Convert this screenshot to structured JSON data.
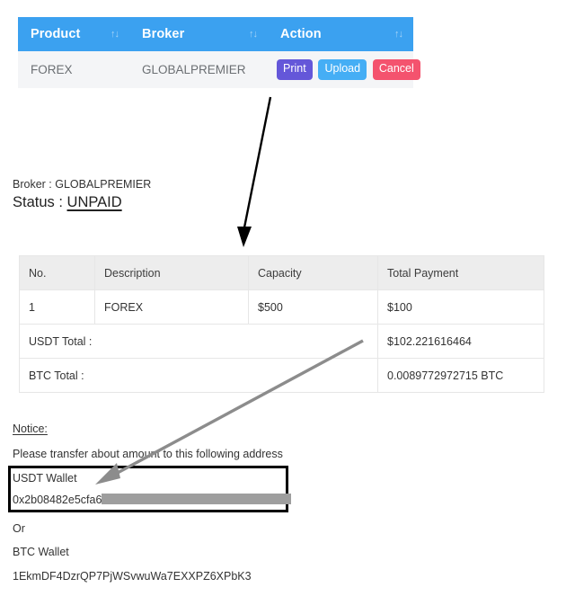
{
  "action_table": {
    "columns": [
      {
        "label": "Product",
        "sort_icon": "sort-updown-icon"
      },
      {
        "label": "Broker",
        "sort_icon": "sort-updown-icon"
      },
      {
        "label": "Action",
        "sort_icon": "sort-updown-icon"
      }
    ],
    "sort_glyph": "↑↓",
    "rows": [
      {
        "product": "FOREX",
        "broker": "GLOBALPREMIER",
        "buttons": [
          {
            "label": "Print",
            "color": "#6457d9"
          },
          {
            "label": "Upload",
            "color": "#45aef5"
          },
          {
            "label": "Cancel",
            "color": "#f4536e"
          }
        ]
      }
    ],
    "header_color": "#3ba1f0",
    "row_color": "#f4f5f7"
  },
  "summary": {
    "broker_label": "Broker : ",
    "broker_value": "GLOBALPREMIER",
    "status_label": "Status : ",
    "status_value": "UNPAID"
  },
  "invoice": {
    "columns": [
      "No.",
      "Description",
      "Capacity",
      "Total Payment"
    ],
    "rows": [
      {
        "no": "1",
        "description": "FOREX",
        "capacity": "$500",
        "total_payment": "$100"
      }
    ],
    "totals": [
      {
        "label": "USDT Total :",
        "value": "$102.221616464"
      },
      {
        "label": "BTC Total :",
        "value": "0.0089772972715 BTC"
      }
    ]
  },
  "notice": {
    "heading": "Notice:",
    "text": "Please transfer about amount to this following address",
    "usdt_wallet_label": "USDT Wallet",
    "usdt_wallet_address_visible": "0x2b08482e5cfa6",
    "usdt_wallet_address_redacted": true,
    "or_text": "Or",
    "btc_wallet_label": "BTC Wallet",
    "btc_wallet_address": "1EkmDF4DzrQP7PjWSvwuWa7EXXPZ6XPbK3"
  },
  "annotations": [
    {
      "name": "arrow-print-to-invoice-table",
      "color": "#000000"
    },
    {
      "name": "arrow-usdt-total-to-usdt-wallet",
      "color": "#8c8c8c"
    }
  ]
}
